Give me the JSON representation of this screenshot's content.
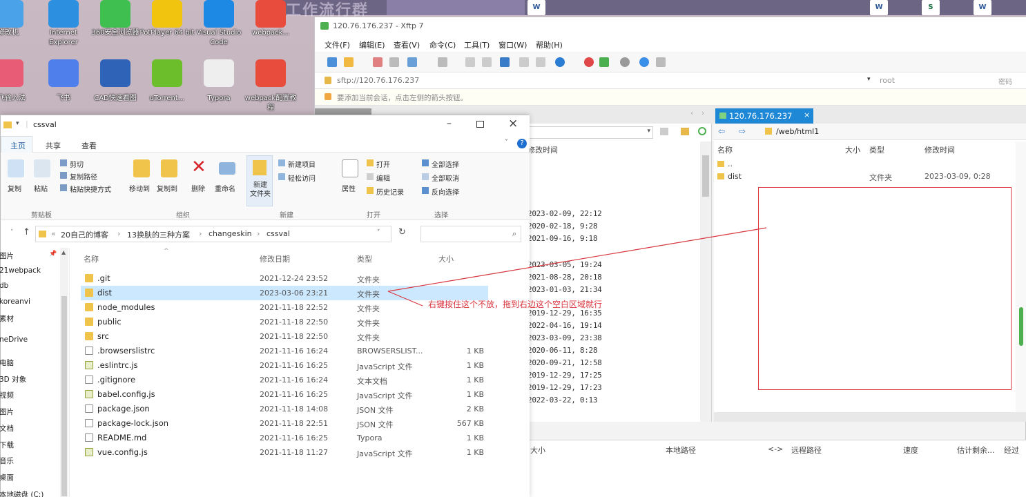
{
  "desktop": {
    "watermark": "工作流行群",
    "icons": [
      {
        "label": "修改机",
        "color": "#4aa3e8"
      },
      {
        "label": "Internet Explorer",
        "color": "#2d8fdf"
      },
      {
        "label": "360安全浏览器",
        "color": "#3fbf4f"
      },
      {
        "label": "PotPlayer 64 bit",
        "color": "#f1c40f"
      },
      {
        "label": "Visual Studio Code",
        "color": "#1e88e5"
      },
      {
        "label": "webpack...",
        "color": "#e74c3c"
      },
      {
        "label": "讯飞输入法",
        "color": "#e85c75"
      },
      {
        "label": "飞书",
        "color": "#4f7fea"
      },
      {
        "label": "CAD快速看图",
        "color": "#2f63b8"
      },
      {
        "label": "uTorrent...",
        "color": "#6cbf2a"
      },
      {
        "label": "Typora",
        "color": "#eeeeee"
      },
      {
        "label": "webpack配置教程",
        "color": "#e74c3c"
      }
    ],
    "doc_icons": [
      "W",
      "W",
      "S",
      "W"
    ]
  },
  "xftp": {
    "title": "120.76.176.237 - Xftp 7",
    "menu": [
      "文件(F)",
      "编辑(E)",
      "查看(V)",
      "命令(C)",
      "工具(T)",
      "窗口(W)",
      "帮助(H)"
    ],
    "address": "sftp://120.76.176.237",
    "user": "root",
    "password_label": "密码",
    "hint": "要添加当前会话，点击左侧的箭头按钮。",
    "remote_tab": "120.76.176.237",
    "remote_path": "/web/html1",
    "local_header_mtime": "修改时间",
    "local_dates": [
      "2023-02-09, 22:12",
      "2020-02-18, 9:28",
      "2021-09-16, 9:18",
      "2023-03-05, 19:24",
      "2021-08-28, 20:18",
      "2023-01-03, 21:34",
      "2019-12-29, 16:35",
      "2022-04-16, 19:14",
      "2023-03-09, 23:38",
      "2020-06-11, 8:28",
      "2020-09-21, 12:58",
      "2019-12-29, 17:25",
      "2019-12-29, 17:23",
      "2022-03-22, 0:13"
    ],
    "remote_headers": {
      "name": "名称",
      "size": "大小",
      "type": "类型",
      "mtime": "修改时间"
    },
    "remote_rows": [
      {
        "name": "..",
        "type": "",
        "mtime": ""
      },
      {
        "name": "dist",
        "type": "文件夹",
        "mtime": "2023-03-09, 0:28"
      }
    ],
    "transfer_headers": [
      "大小",
      "本地路径",
      "<->",
      "远程路径",
      "速度",
      "估计剩余...",
      "经过"
    ]
  },
  "explorer": {
    "title": "cssval",
    "ribbon_tabs": [
      "主页",
      "共享",
      "查看"
    ],
    "clipboard": {
      "copy": "复制",
      "paste": "粘贴",
      "cut": "剪切",
      "copy_path": "复制路径",
      "paste_shortcut": "粘贴快捷方式",
      "group": "剪贴板"
    },
    "organize": {
      "move_to": "移动到",
      "copy_to": "复制到",
      "delete": "删除",
      "rename": "重命名",
      "group": "组织"
    },
    "new": {
      "new_folder": "新建\n文件夹",
      "new_item": "新建项目",
      "easy_access": "轻松访问",
      "group": "新建"
    },
    "open": {
      "properties": "属性",
      "open": "打开",
      "edit": "编辑",
      "history": "历史记录",
      "group": "打开"
    },
    "select": {
      "select_all": "全部选择",
      "select_none": "全部取消",
      "invert": "反向选择",
      "group": "选择"
    },
    "breadcrumb": [
      "20自己的博客",
      "13换肤的三种方案",
      "changeskin",
      "cssval"
    ],
    "columns": {
      "name": "名称",
      "date": "修改日期",
      "type": "类型",
      "size": "大小"
    },
    "nav_items": [
      "图片",
      "21webpack",
      "db",
      "koreanvi",
      "素材",
      "neDrive",
      "电脑",
      "3D 对象",
      "视频",
      "图片",
      "文档",
      "下载",
      "音乐",
      "桌面",
      "本地磁盘 (C:)"
    ],
    "files": [
      {
        "name": ".git",
        "date": "2021-12-24 23:52",
        "type": "文件夹",
        "size": "",
        "kind": "folder"
      },
      {
        "name": "dist",
        "date": "2023-03-06 23:21",
        "type": "文件夹",
        "size": "",
        "kind": "folder"
      },
      {
        "name": "node_modules",
        "date": "2021-11-18 22:52",
        "type": "文件夹",
        "size": "",
        "kind": "folder"
      },
      {
        "name": "public",
        "date": "2021-11-18 22:50",
        "type": "文件夹",
        "size": "",
        "kind": "folder"
      },
      {
        "name": "src",
        "date": "2021-11-18 22:50",
        "type": "文件夹",
        "size": "",
        "kind": "folder"
      },
      {
        "name": ".browserslistrc",
        "date": "2021-11-16 16:24",
        "type": "BROWSERSLIST...",
        "size": "1 KB",
        "kind": "file"
      },
      {
        "name": ".eslintrc.js",
        "date": "2021-11-16 16:25",
        "type": "JavaScript 文件",
        "size": "1 KB",
        "kind": "js"
      },
      {
        "name": ".gitignore",
        "date": "2021-11-16 16:24",
        "type": "文本文档",
        "size": "1 KB",
        "kind": "file"
      },
      {
        "name": "babel.config.js",
        "date": "2021-11-16 16:25",
        "type": "JavaScript 文件",
        "size": "1 KB",
        "kind": "js"
      },
      {
        "name": "package.json",
        "date": "2021-11-18 14:08",
        "type": "JSON 文件",
        "size": "2 KB",
        "kind": "file"
      },
      {
        "name": "package-lock.json",
        "date": "2021-11-18 22:51",
        "type": "JSON 文件",
        "size": "567 KB",
        "kind": "file"
      },
      {
        "name": "README.md",
        "date": "2021-11-16 16:25",
        "type": "Typora",
        "size": "1 KB",
        "kind": "file"
      },
      {
        "name": "vue.config.js",
        "date": "2021-11-18 11:27",
        "type": "JavaScript 文件",
        "size": "1 KB",
        "kind": "js"
      }
    ]
  },
  "annotation": {
    "text": "右键按住这个不放，拖到右边这个空白区域就行",
    "color": "#d9363e"
  }
}
